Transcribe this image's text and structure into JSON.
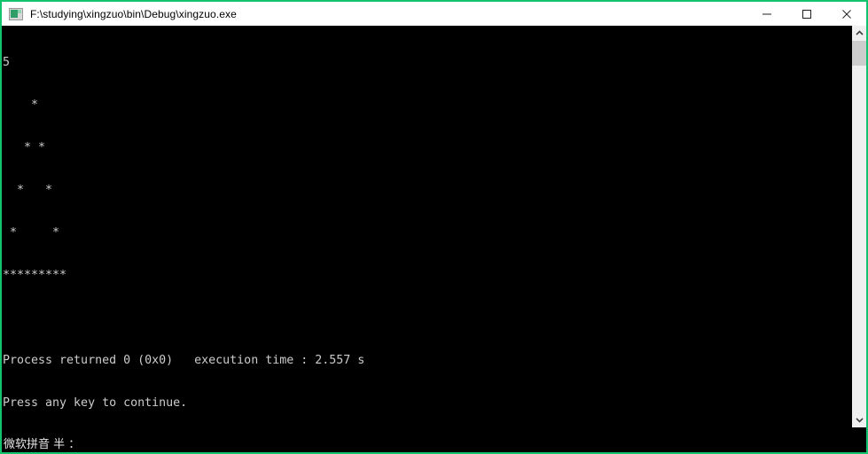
{
  "window": {
    "title": "F:\\studying\\xingzuo\\bin\\Debug\\xingzuo.exe",
    "icon": "console-app-icon",
    "accent_color": "#12c46e",
    "titlebar_background": "#ffffff",
    "console_background": "#000000",
    "console_foreground": "#cccccc",
    "controls": {
      "minimize_label": "—",
      "maximize_label": "☐",
      "close_label": "✕"
    }
  },
  "console": {
    "lines": [
      "5",
      "    *",
      "   * *",
      "  *   *",
      " *     *",
      "*********",
      "",
      "Process returned 0 (0x0)   execution time : 2.557 s",
      "Press any key to continue."
    ],
    "input_number": "5",
    "pattern_rows": [
      "    *",
      "   * *",
      "  *   *",
      " *     *",
      "*********"
    ],
    "exit_line": "Process returned 0 (0x0)   execution time : 2.557 s",
    "prompt_line": "Press any key to continue.",
    "return_code": "0",
    "return_code_hex": "(0x0)",
    "execution_time": "2.557 s",
    "cursor_visible": true
  },
  "scrollbar": {
    "up_arrow": "scroll-up-arrow",
    "down_arrow": "scroll-down-arrow",
    "thumb_position_percent": 0,
    "track_color": "#f0f0f0",
    "thumb_color": "#cdcdcd"
  },
  "ime": {
    "status_text": "微软拼音 半 ：",
    "engine": "微软拼音",
    "width_mode": "半",
    "punctuation": "："
  }
}
